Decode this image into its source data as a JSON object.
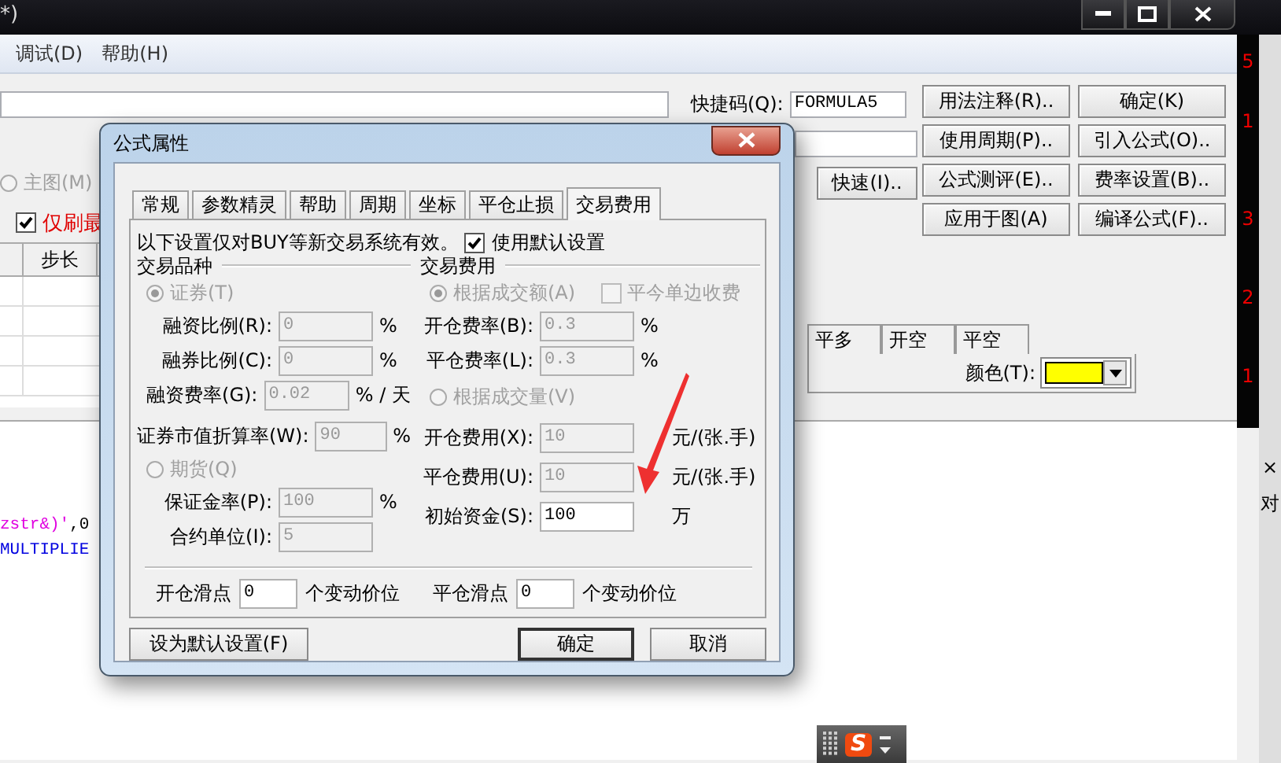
{
  "app_window": {
    "title": "*)",
    "menu": [
      "调试(D)",
      "帮助(H)"
    ],
    "shortcut": {
      "label": "快捷码(Q):",
      "value": "FORMULA5"
    },
    "buttons": [
      "用法注释(R)..",
      "确定(K)",
      "使用周期(P)..",
      "引入公式(O)..",
      "公式测评(E)..",
      "费率设置(B)..",
      "应用于图(A)",
      "编译公式(F).."
    ],
    "quick_button": "快速(I)..",
    "main_chart_radio": {
      "label": "主图(M)",
      "selected": false,
      "disabled": true
    },
    "refresh_checkbox": {
      "label": "仅刷最",
      "checked": true
    },
    "table": {
      "columns": [
        "步长"
      ]
    },
    "line_tabs": [
      {
        "label": "平多",
        "selected": false
      },
      {
        "label": "开空",
        "selected": false
      },
      {
        "label": "平空",
        "selected": false
      }
    ],
    "color_picker": {
      "label": "颜色(T):",
      "color": "#ffff00"
    },
    "code_lines": [
      {
        "segments": [
          {
            "text": "zstr&)'",
            "kind": "string"
          },
          {
            "text": ",0",
            "kind": "plain"
          }
        ]
      },
      {
        "segments": [
          {
            "text": "MULTIPLIE",
            "kind": "keyword"
          }
        ]
      }
    ]
  },
  "right_strip": {
    "numbers": [
      "5",
      "1",
      "3",
      "2",
      "1"
    ],
    "panel": [
      "×",
      "对"
    ]
  },
  "dialog": {
    "title": "公式属性",
    "tabs": [
      {
        "label": "常规",
        "selected": false
      },
      {
        "label": "参数精灵",
        "selected": false
      },
      {
        "label": "帮助",
        "selected": false
      },
      {
        "label": "周期",
        "selected": false
      },
      {
        "label": "坐标",
        "selected": false
      },
      {
        "label": "平仓止损",
        "selected": false
      },
      {
        "label": "交易费用",
        "selected": true
      }
    ],
    "notice": "以下设置仅对BUY等新交易系统有效。",
    "use_default": {
      "label": "使用默认设置",
      "checked": true
    },
    "instrument_group": {
      "title": "交易品种",
      "securities": {
        "label": "证券(T)",
        "selected": true,
        "disabled": true
      },
      "securities_fields": [
        {
          "label": "融资比例(R):",
          "value": "0",
          "unit": "%",
          "disabled": true
        },
        {
          "label": "融券比例(C):",
          "value": "0",
          "unit": "%",
          "disabled": true
        },
        {
          "label": "融资费率(G):",
          "value": "0.02",
          "unit": "% / 天",
          "disabled": true
        }
      ],
      "market_value_rate": {
        "label": "证券市值折算率(W):",
        "value": "90",
        "unit": "%",
        "disabled": true
      },
      "futures": {
        "label": "期货(Q)",
        "selected": false,
        "disabled": true
      },
      "futures_fields": [
        {
          "label": "保证金率(P):",
          "value": "100",
          "unit": "%",
          "disabled": true
        },
        {
          "label": "合约单位(I):",
          "value": "5",
          "disabled": true
        }
      ]
    },
    "fee_group": {
      "title": "交易费用",
      "by_amount": {
        "label": "根据成交额(A)",
        "selected": true,
        "disabled": true
      },
      "close_today_one_side": {
        "label": "平今单边收费",
        "checked": false,
        "disabled": true
      },
      "amount_fields": [
        {
          "label": "开仓费率(B):",
          "value": "0.3",
          "unit": "%",
          "disabled": true
        },
        {
          "label": "平仓费率(L):",
          "value": "0.3",
          "unit": "%",
          "disabled": true
        }
      ],
      "by_volume": {
        "label": "根据成交量(V)",
        "selected": false,
        "disabled": true
      },
      "volume_fields": [
        {
          "label": "开仓费用(X):",
          "value": "10",
          "unit": "元/(张.手)",
          "disabled": true
        },
        {
          "label": "平仓费用(U):",
          "value": "10",
          "unit": "元/(张.手)",
          "disabled": true
        },
        {
          "label": "初始资金(S):",
          "value": "100",
          "unit": "万",
          "disabled": false
        }
      ]
    },
    "slippage": [
      {
        "label": "开仓滑点",
        "value": "0",
        "unit": "个变动价位"
      },
      {
        "label": "平仓滑点",
        "value": "0",
        "unit": "个变动价位"
      }
    ],
    "buttons": [
      {
        "label": "设为默认设置(F)",
        "kind": "plain"
      },
      {
        "label": "确定",
        "kind": "default"
      },
      {
        "label": "取消",
        "kind": "plain"
      }
    ]
  },
  "ime_bar": {
    "logo": "S"
  }
}
